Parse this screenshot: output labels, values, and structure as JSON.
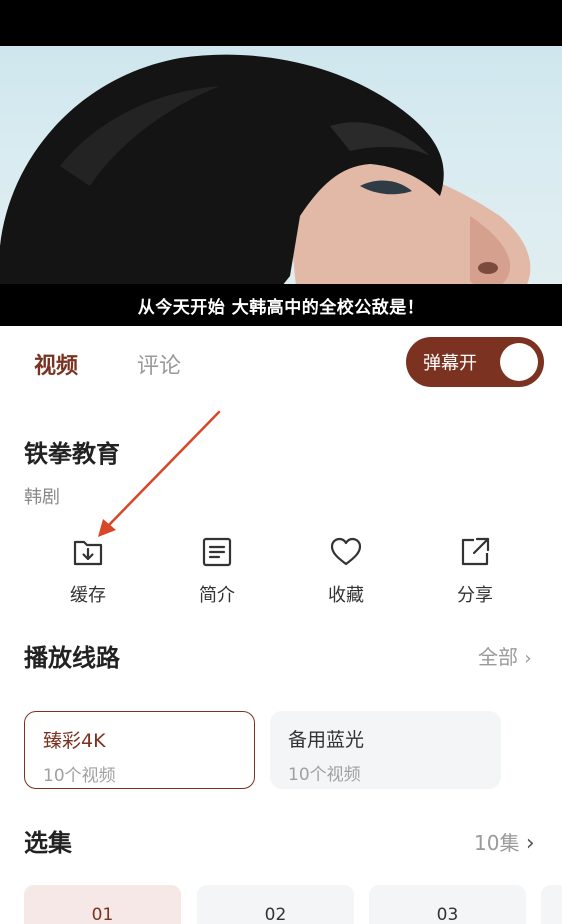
{
  "video": {
    "subtitle": "从今天开始 大韩高中的全校公敌是！"
  },
  "tabs": [
    {
      "label": "视频",
      "active": true
    },
    {
      "label": "评论",
      "active": false
    }
  ],
  "danmaku": {
    "label": "弹幕开",
    "on": true
  },
  "show": {
    "title": "铁拳教育",
    "genre": "韩剧"
  },
  "actions": [
    {
      "label": "缓存",
      "icon": "download-folder-icon"
    },
    {
      "label": "简介",
      "icon": "document-icon"
    },
    {
      "label": "收藏",
      "icon": "heart-icon"
    },
    {
      "label": "分享",
      "icon": "share-icon"
    }
  ],
  "routes": {
    "title": "播放线路",
    "more": "全部",
    "items": [
      {
        "name": "臻彩4K",
        "count": "10个视频",
        "selected": true
      },
      {
        "name": "备用蓝光",
        "count": "10个视频",
        "selected": false
      }
    ]
  },
  "episodes": {
    "title": "选集",
    "more": "10集",
    "items": [
      "01",
      "02",
      "03"
    ]
  },
  "colors": {
    "accent": "#7b3220",
    "muted": "#9a9a9a",
    "card_bg": "#f4f5f7",
    "annotation_arrow": "#d9462a"
  }
}
